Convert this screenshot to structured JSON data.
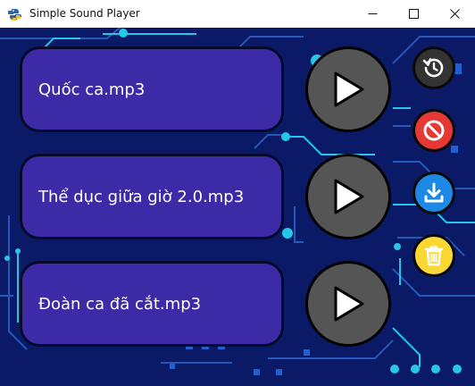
{
  "window": {
    "title": "Simple Sound Player",
    "controls": {
      "minimize": "minimize",
      "maximize": "maximize",
      "close": "close"
    }
  },
  "tracks": [
    {
      "name": "Quốc ca.mp3"
    },
    {
      "name": "Thể dục giữa giờ 2.0.mp3"
    },
    {
      "name": "Đoàn ca đã cắt.mp3"
    }
  ],
  "side_buttons": [
    {
      "icon": "replay-icon",
      "color": "#333333"
    },
    {
      "icon": "stop-icon",
      "color": "#e53935"
    },
    {
      "icon": "download-icon",
      "color": "#1e88e5"
    },
    {
      "icon": "trash-icon",
      "color": "#fdd835"
    }
  ],
  "theme": {
    "background": "#0b1a66",
    "track_fill": "#3d2aa6",
    "play_fill": "#555555",
    "accent": "#25c6e8"
  }
}
